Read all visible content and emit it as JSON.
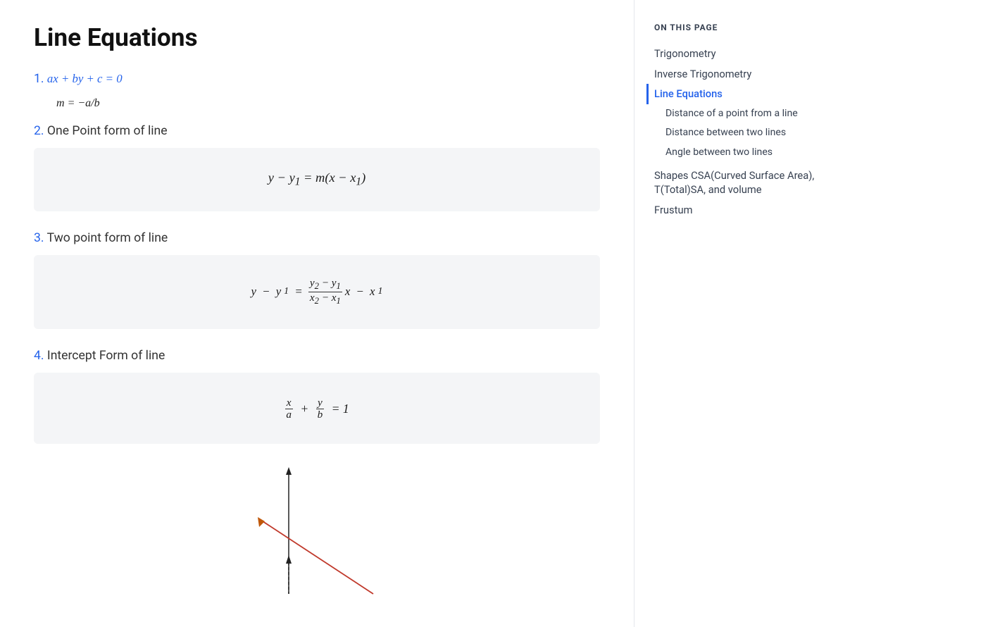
{
  "page": {
    "title": "Line Equations"
  },
  "sidebar": {
    "section_title": "ON THIS PAGE",
    "items": [
      {
        "id": "trigonometry",
        "label": "Trigonometry",
        "active": false,
        "indent": 0
      },
      {
        "id": "inverse-trig",
        "label": "Inverse Trigonometry",
        "active": false,
        "indent": 0
      },
      {
        "id": "line-equations",
        "label": "Line Equations",
        "active": true,
        "indent": 0
      },
      {
        "id": "distance-point",
        "label": "Distance of a point from a line",
        "active": false,
        "indent": 1
      },
      {
        "id": "distance-lines",
        "label": "Distance between two lines",
        "active": false,
        "indent": 1
      },
      {
        "id": "angle-lines",
        "label": "Angle between two lines",
        "active": false,
        "indent": 1
      },
      {
        "id": "shapes-csa",
        "label": "Shapes CSA(Curved Surface Area), T(Total)SA, and volume",
        "active": false,
        "indent": 0
      },
      {
        "id": "frustum",
        "label": "Frustum",
        "active": false,
        "indent": 0
      }
    ]
  },
  "sections": [
    {
      "num": "1.",
      "heading": "ax + by + c = 0",
      "type": "inline",
      "formula": "m = −a/b"
    },
    {
      "num": "2.",
      "heading": "One Point form of line",
      "type": "box",
      "formula": "y − y₁ = m(x − x₁)"
    },
    {
      "num": "3.",
      "heading": "Two point form of line",
      "type": "box",
      "formula": "y − y₁ = ((y₂ − y₁)/(x₂ − x₁))x − x₁"
    },
    {
      "num": "4.",
      "heading": "Intercept Form of line",
      "type": "box",
      "formula": "x/a + y/b = 1"
    }
  ]
}
